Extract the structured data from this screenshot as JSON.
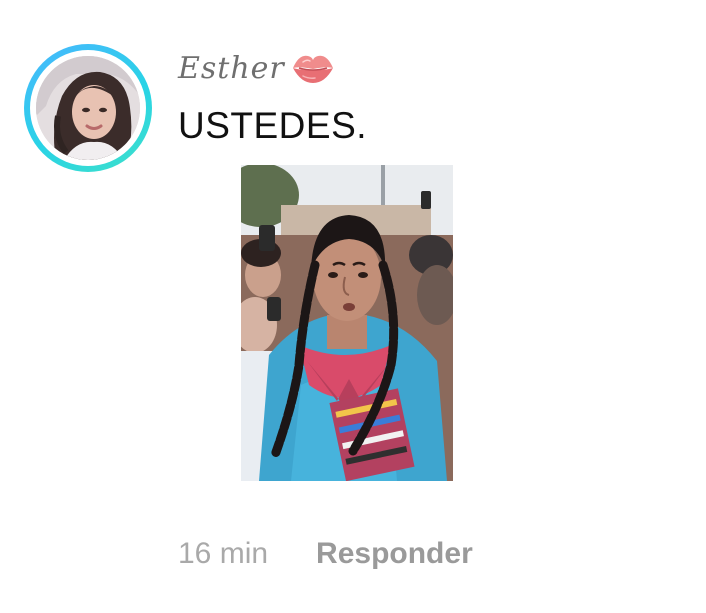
{
  "comment": {
    "author": {
      "name": "Esther",
      "emoji_icon": "kiss-lips-icon",
      "avatar_ring_colors": [
        "#49b6ff",
        "#3ee0c9"
      ]
    },
    "text": "USTEDES.",
    "attached_image": "photo-person-braids-blue-sweater",
    "time": "16 min",
    "reply_label": "Responder"
  }
}
